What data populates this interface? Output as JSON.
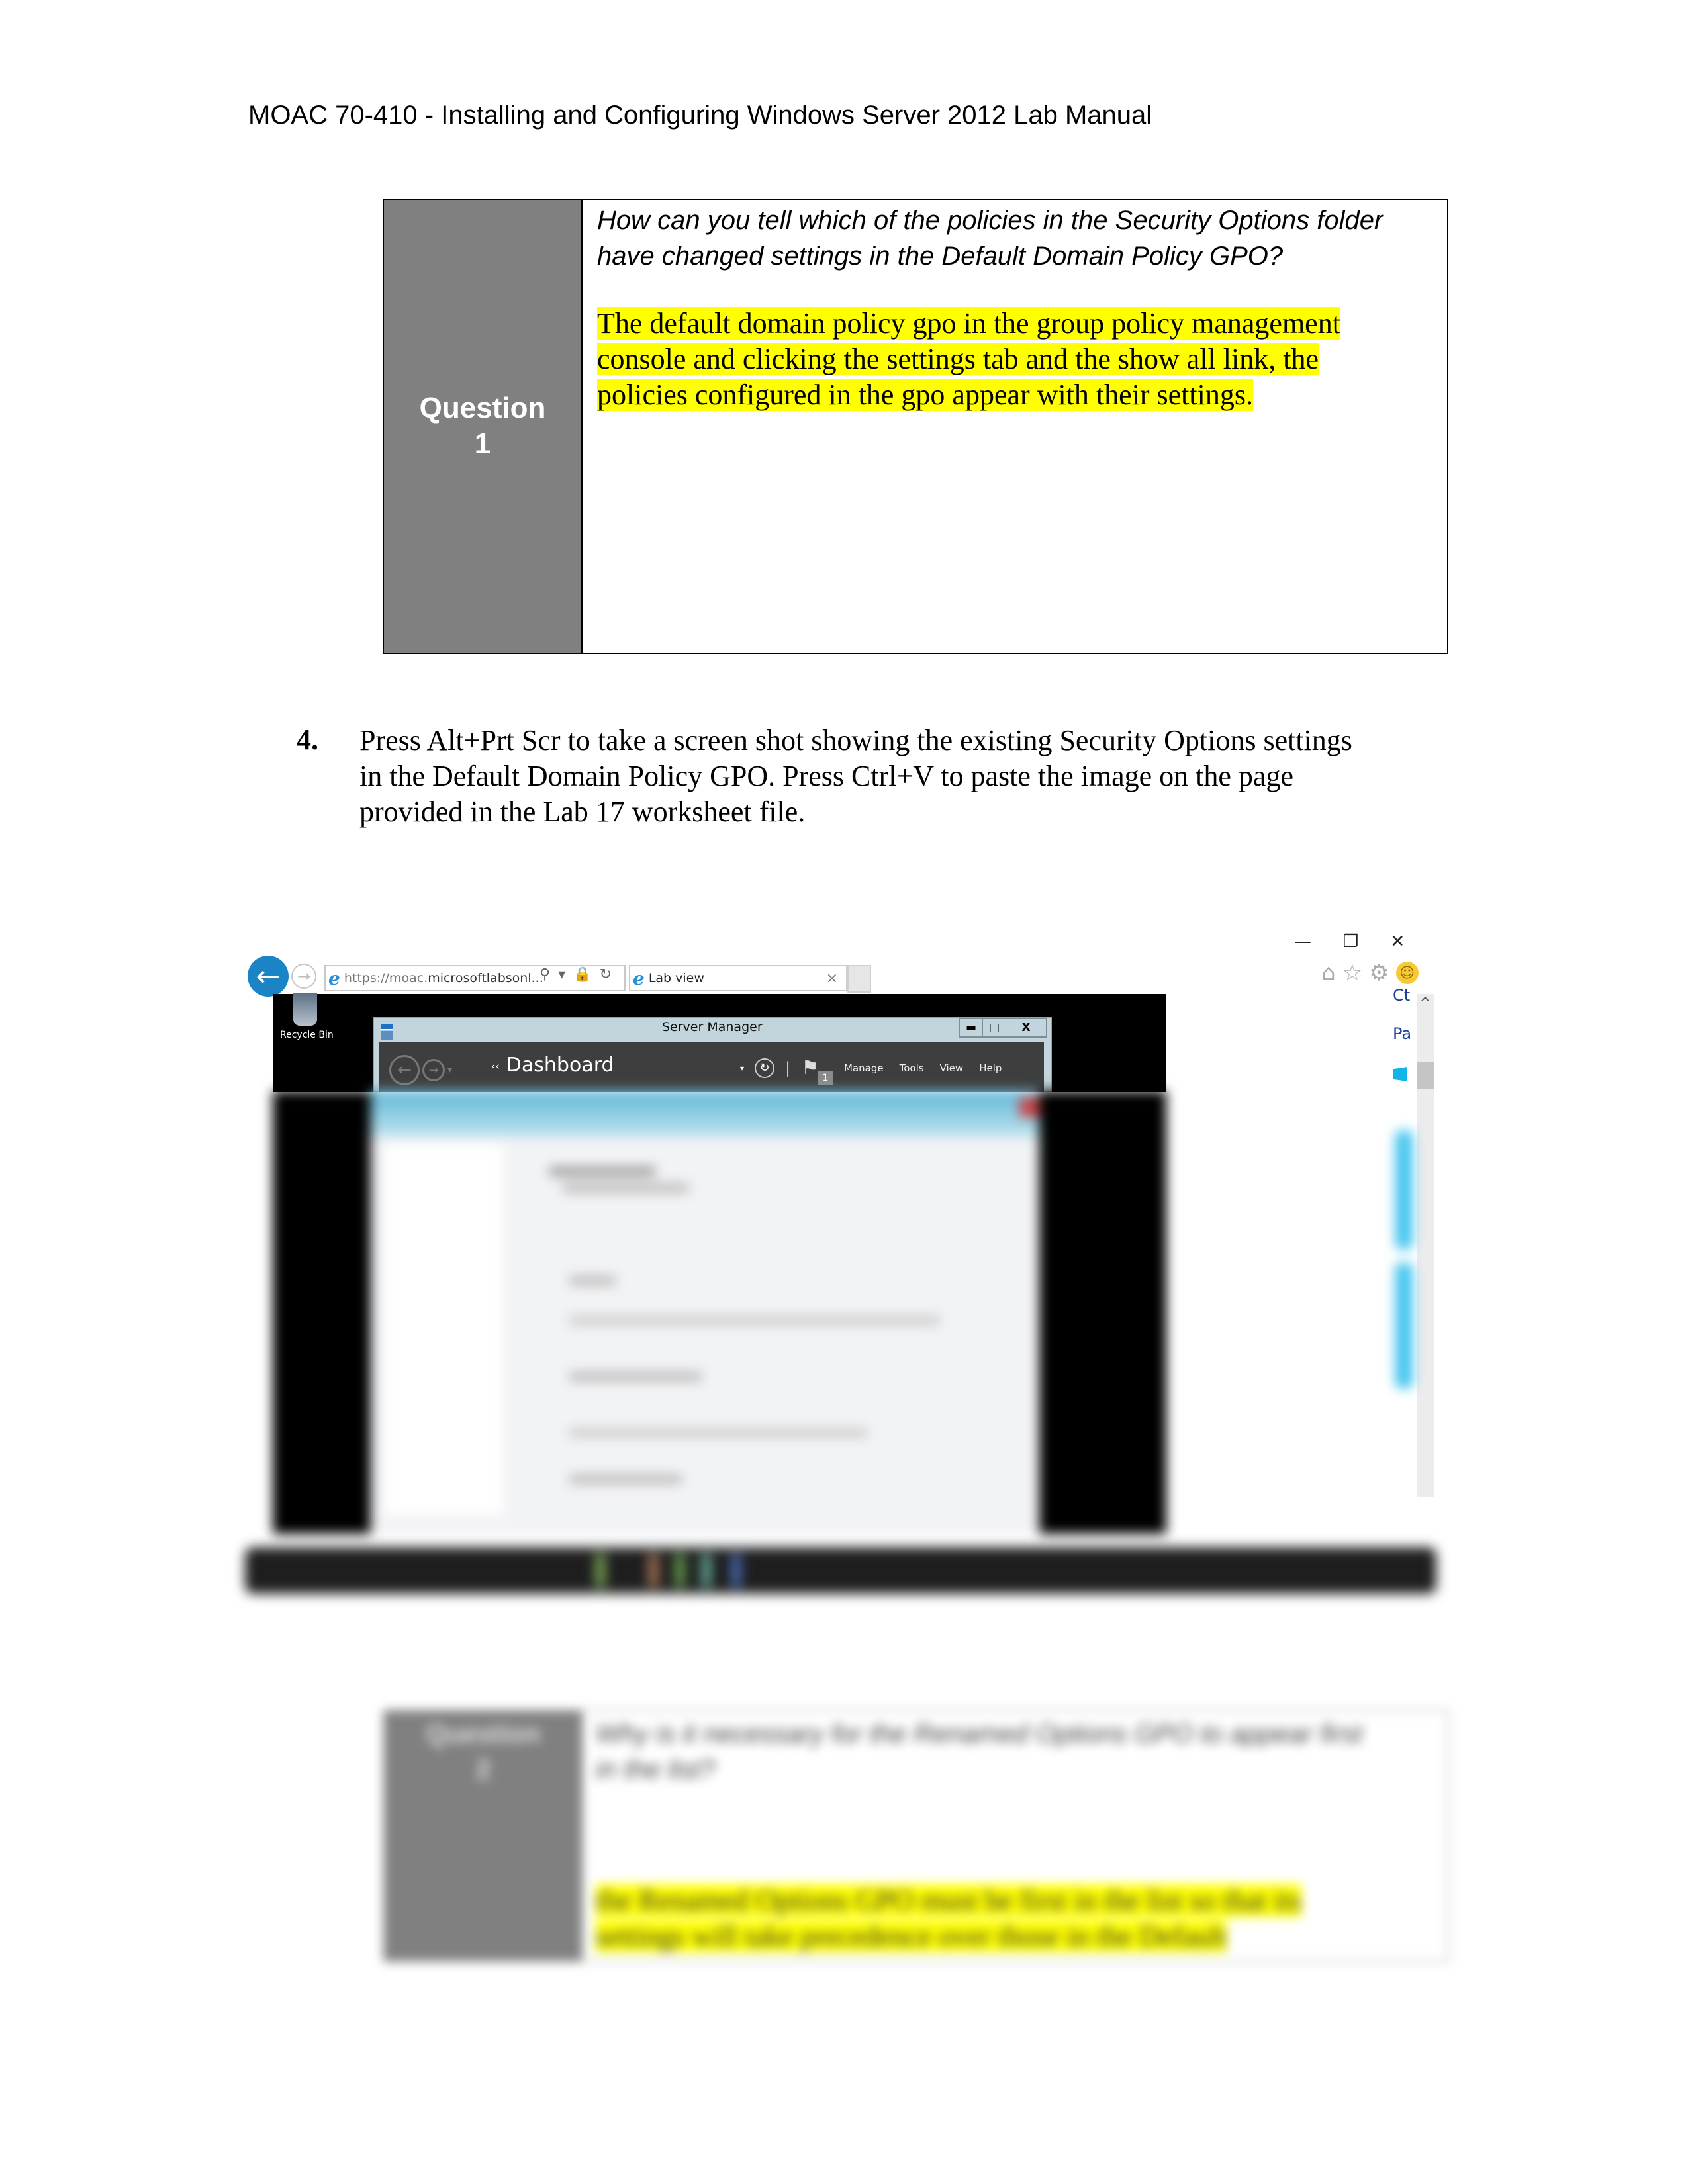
{
  "header": {
    "title": "MOAC 70-410 - Installing and Configuring Windows Server 2012 Lab Manual"
  },
  "question1": {
    "label_word": "Question",
    "label_number": "1",
    "question": "How can you tell which of the policies in the Security Options folder have changed settings in the Default Domain Policy GPO?",
    "answer": "The default domain policy gpo in the group policy management console and clicking the settings tab and the show all link, the policies configured in the gpo appear with their settings.",
    "colors": {
      "label_bg": "#808080",
      "highlight": "#ffff00"
    }
  },
  "step4": {
    "number": "4.",
    "text": "Press Alt+Prt Scr to take a screen shot showing the existing Security Options settings in the Default Domain Policy GPO. Press Ctrl+V to paste the image on the page provided in the Lab 17 worksheet file."
  },
  "screenshot": {
    "browser": {
      "back_icon": "back-arrow-icon",
      "forward_icon": "forward-arrow-icon",
      "ie_icon_glyph": "e",
      "url_protocol": "https://moac.",
      "url_rest": "microsoftlabsonl...",
      "addr_icons": [
        "⚲",
        "▾",
        "🔒",
        "↻"
      ],
      "tab_label": "Lab view",
      "tab_close": "×",
      "window_controls": [
        "—",
        "❐",
        "✕"
      ],
      "tool_icons": [
        "⌂",
        "☆",
        "⚙"
      ],
      "smiley": "☺"
    },
    "desktop": {
      "recycle_bin_label": "Recycle Bin"
    },
    "server_manager": {
      "title": "Server Manager",
      "window_controls": [
        "▬",
        "□",
        "X"
      ],
      "breadcrumb_chevron": "‹‹",
      "breadcrumb": "Dashboard",
      "dropdown_arrow": "▾",
      "refresh_icon": "↻",
      "separator": "|",
      "flag_icon": "⚑",
      "notification_count": "1",
      "menu": [
        "Manage",
        "Tools",
        "View",
        "Help"
      ]
    },
    "side_panel": {
      "items": [
        "Ct",
        "Pa"
      ],
      "scroll_up": "^"
    }
  },
  "question2_blurred": {
    "label_word": "Question",
    "label_number": "2",
    "question": "Why is it necessary for the Renamed Options GPO to appear first in the list?",
    "answer": "the Renamed Options GPO must be first in the list so that its settings will take precedence over those in the Default"
  }
}
